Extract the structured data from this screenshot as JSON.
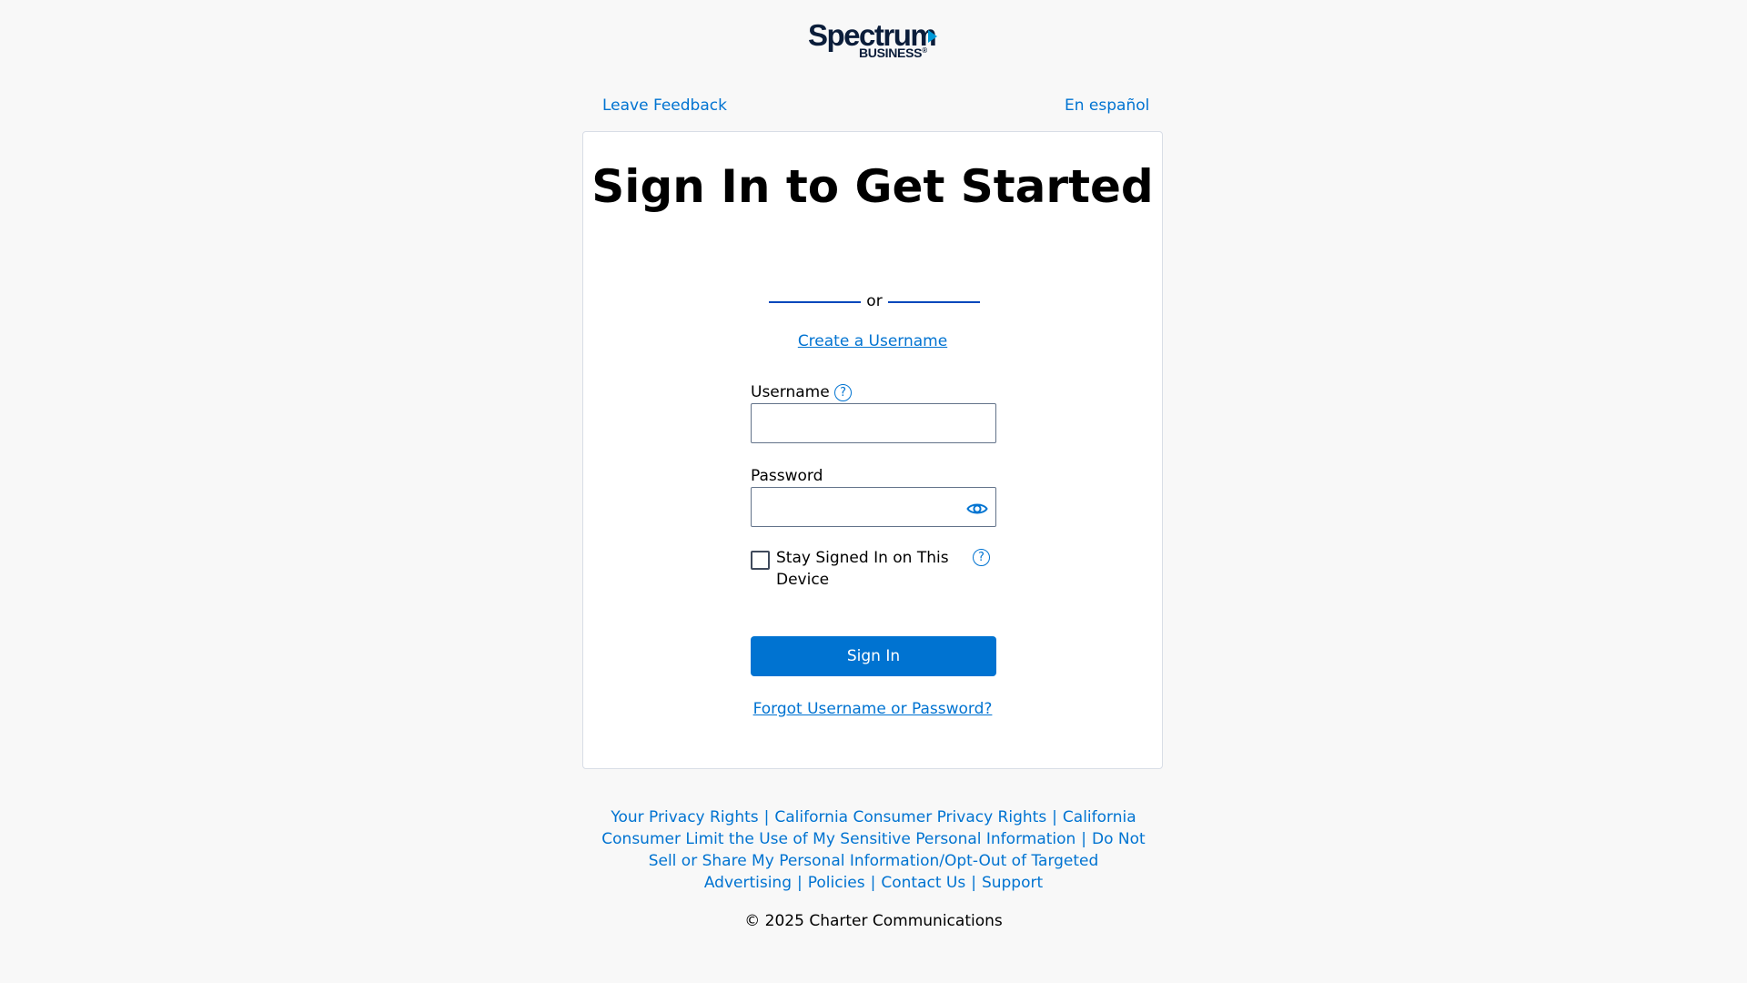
{
  "brand": {
    "name": "Spectrum",
    "sub": "BUSINESS",
    "registered_mark": "®"
  },
  "top_links": {
    "feedback": "Leave Feedback",
    "language": "En español"
  },
  "card": {
    "title": "Sign In to Get Started",
    "divider_text": "or",
    "create_link": "Create a Username",
    "username_label": "Username",
    "username_value": "",
    "password_label": "Password",
    "password_value": "",
    "stay_signed_in_label": "Stay Signed In on This Device",
    "stay_signed_in_checked": false,
    "help_glyph": "?",
    "signin_button": "Sign In",
    "forgot_link": "Forgot Username or Password?"
  },
  "footer": {
    "links": [
      "Your Privacy Rights",
      "California Consumer Privacy Rights",
      "California Consumer Limit the Use of My Sensitive Personal Information",
      "Do Not Sell or Share My Personal Information/Opt-Out of Targeted Advertising",
      "Policies",
      "Contact Us",
      "Support"
    ],
    "copyright": "© 2025 Charter Communications"
  },
  "colors": {
    "link": "#0073d1",
    "button": "#0073d1",
    "divider": "#0047bb",
    "background": "#f8f8f8",
    "brand_arrow": "#0099d8"
  },
  "icons": {
    "help": "question-circle-icon",
    "show_password": "eye-icon",
    "brand_arrow": "play-arrow-icon"
  }
}
